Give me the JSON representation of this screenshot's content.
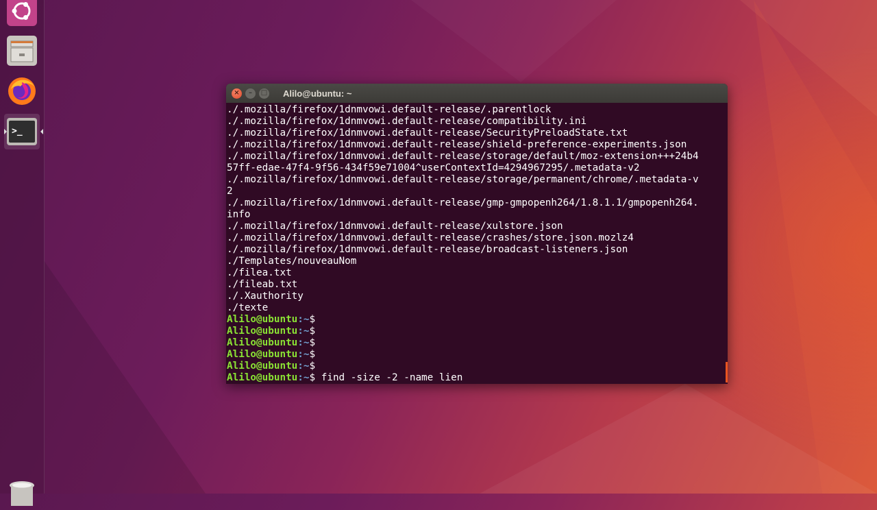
{
  "window": {
    "title": "Alilo@ubuntu: ~"
  },
  "launcher": {
    "items": [
      {
        "name": "ubuntu-dash-icon"
      },
      {
        "name": "files-icon"
      },
      {
        "name": "firefox-icon"
      },
      {
        "name": "terminal-icon",
        "active": true,
        "glyph": ">_"
      },
      {
        "name": "trash-icon"
      }
    ]
  },
  "terminal": {
    "output": [
      "./.mozilla/firefox/1dnmvowi.default-release/.parentlock",
      "./.mozilla/firefox/1dnmvowi.default-release/compatibility.ini",
      "./.mozilla/firefox/1dnmvowi.default-release/SecurityPreloadState.txt",
      "./.mozilla/firefox/1dnmvowi.default-release/shield-preference-experiments.json",
      "./.mozilla/firefox/1dnmvowi.default-release/storage/default/moz-extension+++24b4",
      "57ff-edae-47f4-9f56-434f59e71004^userContextId=4294967295/.metadata-v2",
      "./.mozilla/firefox/1dnmvowi.default-release/storage/permanent/chrome/.metadata-v",
      "2",
      "./.mozilla/firefox/1dnmvowi.default-release/gmp-gmpopenh264/1.8.1.1/gmpopenh264.",
      "info",
      "./.mozilla/firefox/1dnmvowi.default-release/xulstore.json",
      "./.mozilla/firefox/1dnmvowi.default-release/crashes/store.json.mozlz4",
      "./.mozilla/firefox/1dnmvowi.default-release/broadcast-listeners.json",
      "./Templates/nouveauNom",
      "./filea.txt",
      "./fileab.txt",
      "./.Xauthority",
      "./texte"
    ],
    "prompt_user": "Alilo@ubuntu",
    "prompt_path": ":~",
    "prompt_symbol": "$",
    "empty_prompts": 5,
    "current_command": " find -size -2 -name lien"
  },
  "colors": {
    "terminal_bg": "#300a24",
    "prompt_user": "#8ae234",
    "prompt_path": "#729fcf",
    "accent": "#e95420"
  }
}
